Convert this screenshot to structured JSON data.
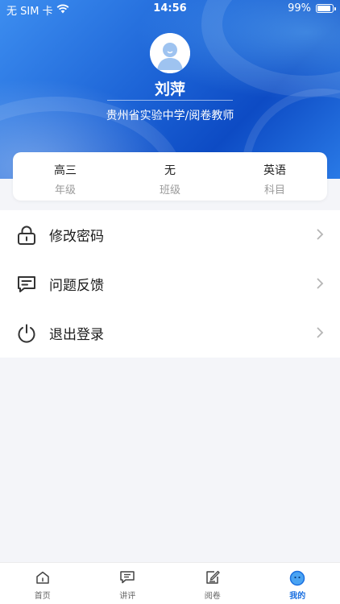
{
  "status_bar": {
    "carrier": "无 SIM 卡",
    "time": "14:56",
    "battery": "99%"
  },
  "profile": {
    "name": "刘萍",
    "school": "贵州省实验中学/阅卷教师"
  },
  "info": [
    {
      "value": "高三",
      "label": "年级"
    },
    {
      "value": "无",
      "label": "班级"
    },
    {
      "value": "英语",
      "label": "科目"
    }
  ],
  "menu": [
    {
      "label": "修改密码",
      "icon": "lock-icon"
    },
    {
      "label": "问题反馈",
      "icon": "message-icon"
    },
    {
      "label": "退出登录",
      "icon": "power-icon"
    }
  ],
  "tabs": [
    {
      "label": "首页",
      "icon": "home-icon"
    },
    {
      "label": "讲评",
      "icon": "comment-icon"
    },
    {
      "label": "阅卷",
      "icon": "grading-icon"
    },
    {
      "label": "我的",
      "icon": "profile-face-icon"
    }
  ],
  "colors": {
    "accent": "#1a6fe0",
    "header_blue": "#1c63d6"
  }
}
